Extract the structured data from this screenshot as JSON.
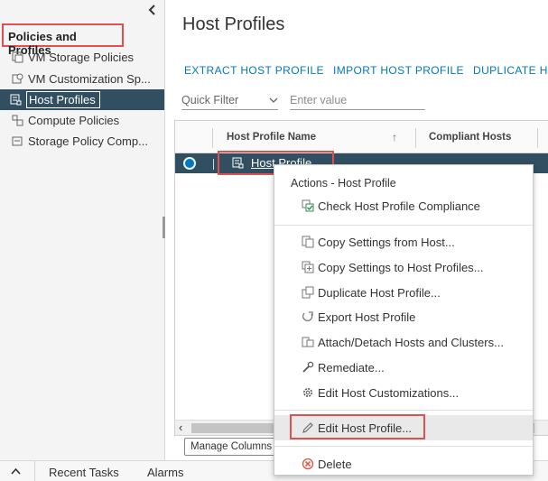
{
  "sidebar": {
    "collapse_icon": "chevron-left",
    "heading": "Policies and Profiles",
    "items": [
      {
        "label": "VM Storage Policies",
        "icon": "vm-storage-policy-icon"
      },
      {
        "label": "VM Customization Sp...",
        "icon": "vm-customization-icon"
      },
      {
        "label": "Host Profiles",
        "icon": "host-profile-icon",
        "active": true
      },
      {
        "label": "Compute Policies",
        "icon": "compute-policy-icon"
      },
      {
        "label": "Storage Policy Comp...",
        "icon": "storage-policy-icon"
      }
    ]
  },
  "main": {
    "title": "Host Profiles",
    "toolbar": {
      "extract": "EXTRACT HOST PROFILE",
      "import": "IMPORT HOST PROFILE",
      "duplicate": "DUPLICATE HO"
    },
    "quick_filter": {
      "label": "Quick Filter"
    },
    "filter_input": {
      "placeholder": "Enter value"
    },
    "grid": {
      "columns": [
        "Host Profile Name",
        "Compliant Hosts"
      ],
      "sort_indicator": "↑",
      "rows": [
        {
          "name": "Host Profile",
          "selected": true
        }
      ]
    },
    "manage_columns": "Manage Columns"
  },
  "context_menu": {
    "title": "Actions - Host Profile",
    "items": [
      {
        "label": "Check Host Profile Compliance",
        "icon": "compliance-check-icon"
      },
      {
        "label": "Copy Settings from Host...",
        "icon": "copy-from-host-icon"
      },
      {
        "label": "Copy Settings to Host Profiles...",
        "icon": "copy-to-profiles-icon"
      },
      {
        "label": "Duplicate Host Profile...",
        "icon": "duplicate-icon"
      },
      {
        "label": "Export Host Profile",
        "icon": "export-icon"
      },
      {
        "label": "Attach/Detach Hosts and Clusters...",
        "icon": "attach-detach-icon"
      },
      {
        "label": "Remediate...",
        "icon": "wrench-icon"
      },
      {
        "label": "Edit Host Customizations...",
        "icon": "gear-icon"
      },
      {
        "label": "Edit Host Profile...",
        "icon": "pencil-icon",
        "highlighted": true
      },
      {
        "label": "Delete",
        "icon": "delete-icon"
      }
    ]
  },
  "bottom_bar": {
    "recent_tasks": "Recent Tasks",
    "alarms": "Alarms"
  },
  "colors": {
    "accent": "#0079b8",
    "selected_bg": "#324f61",
    "highlight_box": "#e05050",
    "delete_icon": "#e0503c"
  }
}
